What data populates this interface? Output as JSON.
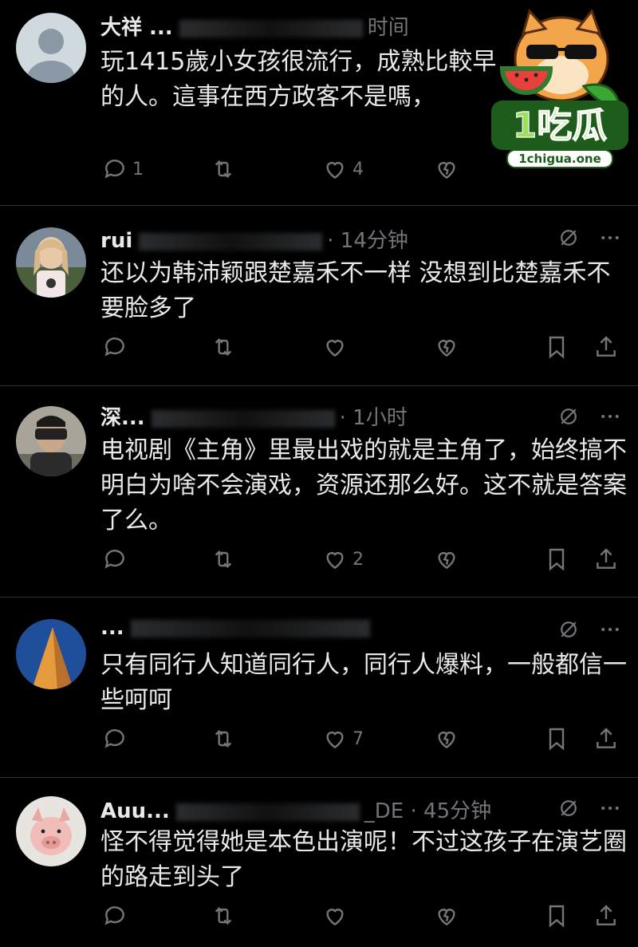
{
  "posts": [
    {
      "name": "大祥 ...",
      "time": "时间",
      "text": "玩1415歲小女孩很流行，成熟比較早的人。這事在西方政客不是嗎，",
      "counts": {
        "reply": "1",
        "repost": "",
        "like": "4",
        "view": ""
      },
      "avatar": "default-avatar"
    },
    {
      "name": "rui",
      "time": "· 14分钟",
      "text": "还以为韩沛颖跟楚嘉禾不一样 没想到比楚嘉禾不要脸多了",
      "counts": {
        "reply": "",
        "repost": "",
        "like": "",
        "view": ""
      },
      "avatar": "girl-avatar"
    },
    {
      "name": "深...",
      "time": "· 1小时",
      "text": "电视剧《主角》里最出戏的就是主角了，始终搞不明白为啥不会演戏，资源还那么好。这不就是答案了么。",
      "counts": {
        "reply": "",
        "repost": "",
        "like": "2",
        "view": ""
      },
      "avatar": "vr-avatar"
    },
    {
      "name": "...",
      "time": "",
      "text": "只有同行人知道同行人，同行人爆料，一般都信一些呵呵",
      "counts": {
        "reply": "",
        "repost": "",
        "like": "7",
        "view": ""
      },
      "avatar": "pyramid-avatar"
    },
    {
      "name": "Auu...",
      "time": "_DE · 45分钟",
      "text": "怪不得觉得她是本色出演呢！不过这孩子在演艺圈的路走到头了",
      "counts": {
        "reply": "",
        "repost": "",
        "like": "",
        "view": ""
      },
      "avatar": "pig-avatar"
    }
  ],
  "watermark": {
    "brand": "1吃瓜",
    "domain": "1chigua.one"
  },
  "colors": {
    "bg": "#000000",
    "text": "#e7e9ea",
    "muted": "#71767b",
    "divider": "#2f3336",
    "logo_green": "#3aa635"
  }
}
